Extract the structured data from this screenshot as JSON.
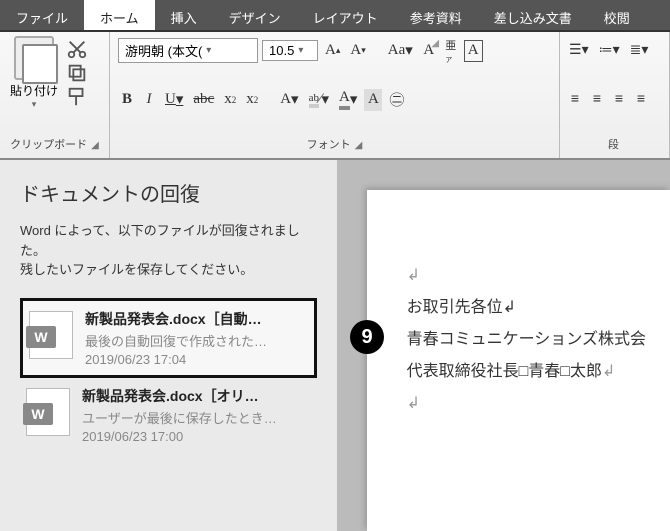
{
  "tabs": {
    "file": "ファイル",
    "home": "ホーム",
    "insert": "挿入",
    "design": "デザイン",
    "layout": "レイアウト",
    "references": "参考資料",
    "mailings": "差し込み文書",
    "review": "校閲"
  },
  "ribbon": {
    "clipboard": {
      "paste": "貼り付け",
      "label": "クリップボード"
    },
    "font": {
      "name": "游明朝 (本文(",
      "size": "10.5",
      "label": "フォント"
    },
    "paragraph": {
      "label": "段"
    }
  },
  "recovery": {
    "title": "ドキュメントの回復",
    "line1": "Word によって、以下のファイルが回復されました。",
    "line2": "残したいファイルを保存してください。",
    "items": [
      {
        "name": "新製品発表会.docx［自動…",
        "desc": "最後の自動回復で作成された…",
        "time": "2019/06/23 17:04"
      },
      {
        "name": "新製品発表会.docx［オリ…",
        "desc": "ユーザーが最後に保存したとき…",
        "time": "2019/06/23 17:00"
      }
    ]
  },
  "callout": "9",
  "document": {
    "l1": "お取引先各位↲",
    "l2": "青春コミュニケーションズ株式会",
    "l3": "代表取締役社長□青春□太郎"
  }
}
